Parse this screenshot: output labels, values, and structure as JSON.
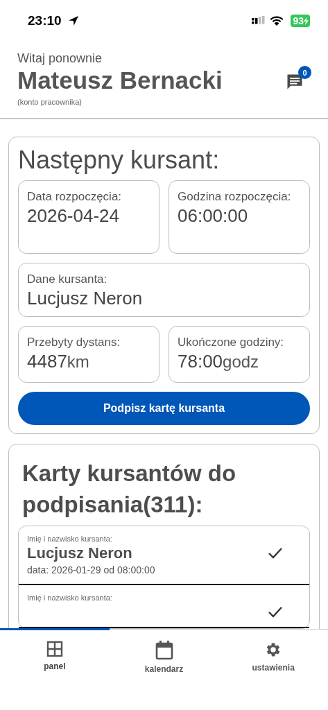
{
  "status_bar": {
    "time": "23:10",
    "battery": "93"
  },
  "header": {
    "greeting": "Witaj ponownie",
    "name": "Mateusz Bernacki",
    "role": "(konto pracownika)",
    "messages_badge": "0"
  },
  "next_student": {
    "title": "Następny kursant:",
    "fields": [
      {
        "label": "Data rozpoczęcia:",
        "value": "2026-04-24"
      },
      {
        "label": "Godzina rozpoczęcia:",
        "value": "06:00:00"
      },
      {
        "label": "Dane kursanta:",
        "value": "Lucjusz Neron"
      },
      {
        "label": "Przebyty dystans:",
        "value": "4487",
        "unit": "km"
      },
      {
        "label": "Ukończone godziny:",
        "value": "78:00",
        "unit": "godz"
      }
    ],
    "button": "Podpisz kartę kursanta"
  },
  "cards_to_sign": {
    "title": "Karty kursantów do podpisania(311):",
    "items": [
      {
        "label": "Imię i nazwisko kursanta:",
        "name": "Lucjusz Neron",
        "date": "data: 2026-01-29 od 08:00:00"
      },
      {
        "label": "Imię i nazwisko kursanta:"
      }
    ]
  },
  "tabs": [
    {
      "label": "panel",
      "selected": true
    },
    {
      "label": "kalendarz",
      "selected": false
    },
    {
      "label": "ustawienia",
      "selected": false
    }
  ]
}
